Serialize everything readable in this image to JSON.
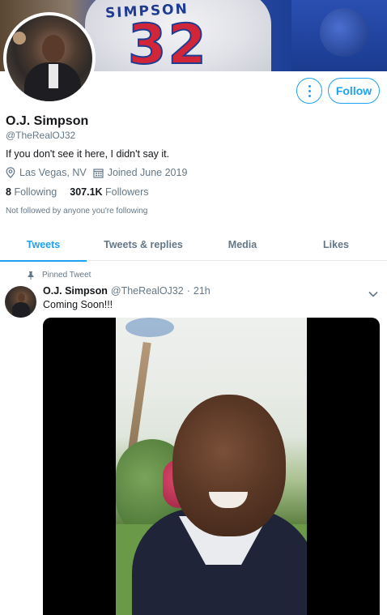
{
  "banner": {
    "jersey_name": "SIMPSON",
    "jersey_number": "32"
  },
  "header_actions": {
    "more_icon": "more-vertical-icon",
    "follow_label": "Follow"
  },
  "profile": {
    "name": "O.J. Simpson",
    "handle": "@TheRealOJ32",
    "bio": "If you don't see it here, I didn't say it.",
    "location": "Las Vegas, NV",
    "joined": "Joined June 2019",
    "following_count": "8",
    "following_label": "Following",
    "followers_count": "307.1K",
    "followers_label": "Followers",
    "followed_note": "Not followed by anyone you're following"
  },
  "tabs": [
    {
      "label": "Tweets",
      "active": true
    },
    {
      "label": "Tweets & replies",
      "active": false
    },
    {
      "label": "Media",
      "active": false
    },
    {
      "label": "Likes",
      "active": false
    }
  ],
  "pinned_tweet": {
    "pin_label": "Pinned Tweet",
    "author_name": "O.J. Simpson",
    "author_handle": "@TheRealOJ32",
    "separator": "·",
    "time": "21h",
    "text": "Coming Soon!!!"
  },
  "colors": {
    "accent": "#1da1f2",
    "secondary_text": "#657786",
    "primary_text": "#14171a"
  }
}
